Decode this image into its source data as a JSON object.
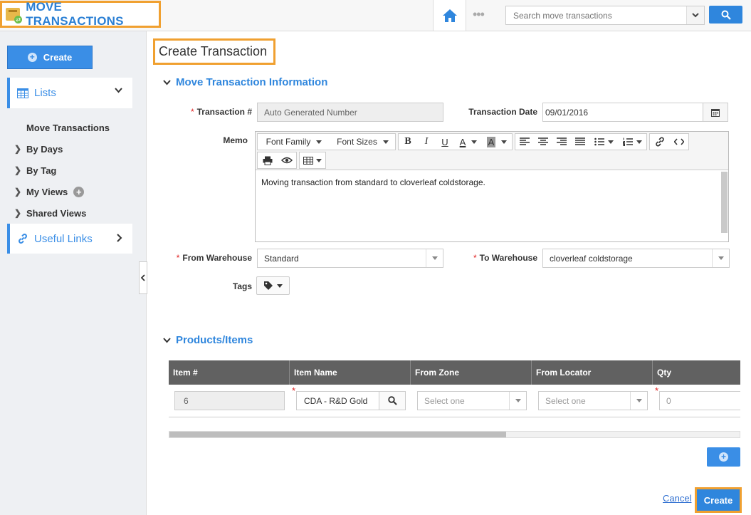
{
  "app": {
    "title": "MOVE TRANSACTIONS",
    "logo_icon": "box-move-icon"
  },
  "header": {
    "search_placeholder": "Search move transactions",
    "home_icon": "home-icon",
    "more_icon": "more-dots-icon",
    "search_icon": "search-icon"
  },
  "sidebar": {
    "create_label": "Create",
    "lists_label": "Lists",
    "nav": [
      "Move Transactions",
      "By Days",
      "By Tag",
      "My Views",
      "Shared Views"
    ],
    "useful_links_label": "Useful Links"
  },
  "page": {
    "title": "Create Transaction"
  },
  "info_section": {
    "title": "Move Transaction Information",
    "transaction_no_label": "Transaction #",
    "transaction_no_value": "Auto Generated Number",
    "transaction_date_label": "Transaction Date",
    "transaction_date_value": "09/01/2016",
    "memo_label": "Memo",
    "memo_text": "Moving transaction from standard to cloverleaf coldstorage.",
    "from_warehouse_label": "From Warehouse",
    "from_warehouse_value": "Standard",
    "to_warehouse_label": "To Warehouse",
    "to_warehouse_value": "cloverleaf coldstorage",
    "tags_label": "Tags"
  },
  "editor_toolbar": {
    "font_family": "Font Family",
    "font_sizes": "Font Sizes",
    "bold": "B",
    "italic": "I",
    "underline": "U",
    "font_color": "A",
    "bg_color": "A"
  },
  "items_section": {
    "title": "Products/Items",
    "columns": [
      "Item #",
      "Item Name",
      "From Zone",
      "From Locator",
      "Qty"
    ],
    "row": {
      "item_no": "6",
      "item_name": "CDA - R&D Gold",
      "from_zone": "Select one",
      "from_locator": "Select one",
      "qty": "0"
    }
  },
  "actions": {
    "cancel": "Cancel",
    "create": "Create"
  },
  "colors": {
    "accent": "#2f86dd",
    "highlight": "#f0a030",
    "header_row": "#616161"
  }
}
